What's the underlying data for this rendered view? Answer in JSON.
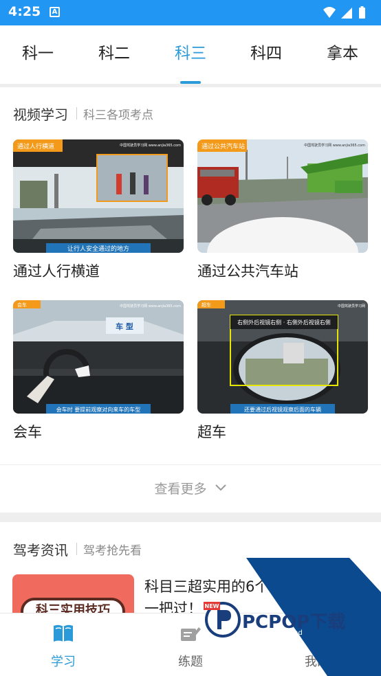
{
  "status_bar": {
    "time": "4:25",
    "notification_icon": "A"
  },
  "tabs": [
    {
      "label": "科一",
      "active": false
    },
    {
      "label": "科二",
      "active": false
    },
    {
      "label": "科三",
      "active": true
    },
    {
      "label": "科四",
      "active": false
    },
    {
      "label": "拿本",
      "active": false
    }
  ],
  "video_section": {
    "title": "视频学习",
    "subtitle": "科三各项考点",
    "videos": [
      {
        "title": "通过人行横道",
        "badge": "通过人行横道",
        "caption": "让行人安全通过的地方",
        "watermark": "中国驾驶员学习网 www.anjia365.com"
      },
      {
        "title": "通过公共汽车站",
        "badge": "通过公共汽车站",
        "caption": "",
        "watermark": "中国驾驶员学习网 www.anjia365.com"
      },
      {
        "title": "会车",
        "badge": "会车",
        "caption": "会车时 要提前观察对向来车的车型",
        "sign": "车 型",
        "watermark": "中国驾驶员学习网 www.anjia365.com"
      },
      {
        "title": "超车",
        "badge": "超车",
        "caption": "还要通过后视镜观察后面的车辆",
        "overlay": "右侧外后视镜右侧 · 右侧外后视镜右侧",
        "watermark": "中国驾驶员学习网"
      }
    ],
    "more_label": "查看更多"
  },
  "news_section": {
    "title": "驾考资讯",
    "subtitle": "驾考抢先看",
    "items": [
      {
        "title": "科目三超实用的6个技巧，宝宝祝你一把过！",
        "thumb_text": "科三实用技巧"
      }
    ]
  },
  "bottom_nav": [
    {
      "label": "学习",
      "icon": "book-icon",
      "active": true
    },
    {
      "label": "练题",
      "icon": "edit-icon",
      "active": false
    },
    {
      "label": "我的",
      "icon": "person-icon",
      "active": false
    }
  ],
  "watermark": {
    "brand": "PCPOP下载",
    "sub": "PCPOP Download",
    "new_badge": "NEW"
  },
  "colors": {
    "status_bar": "#2196f3",
    "accent": "#2a9ad8",
    "text": "#222222",
    "muted": "#888888"
  }
}
